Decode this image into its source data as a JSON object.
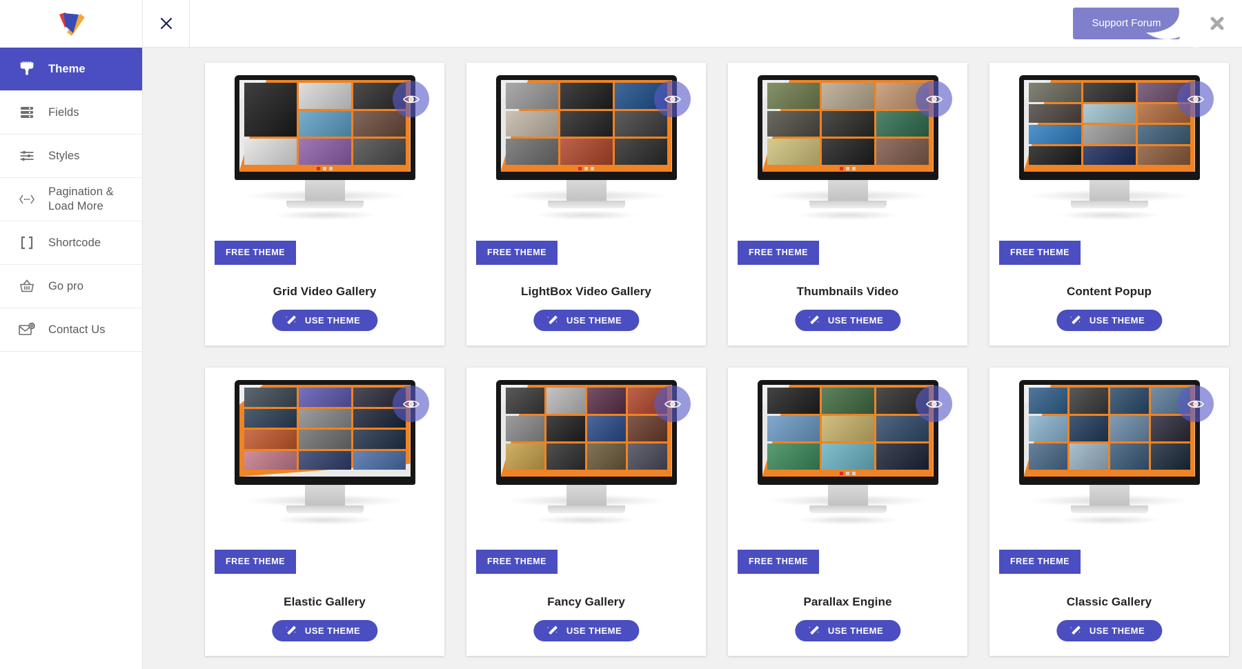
{
  "app": {
    "logo_name": "logo-icon",
    "accent_color": "#4a4ec0",
    "support_button_color": "#7f7fcb",
    "background": "#f1f1f1"
  },
  "topbar": {
    "close_left_icon": "close-icon",
    "support_label": "Support Forum",
    "close_right_icon": "close-icon"
  },
  "sidebar": {
    "items": [
      {
        "label": "Theme",
        "icon": "paint-brush-icon",
        "active": true
      },
      {
        "label": "Fields",
        "icon": "fields-list-icon",
        "active": false
      },
      {
        "label": "Styles",
        "icon": "sliders-icon",
        "active": false
      },
      {
        "label": "Pagination & Load More",
        "icon": "pagination-dots-icon",
        "active": false
      },
      {
        "label": "Shortcode",
        "icon": "brackets-icon",
        "active": false
      },
      {
        "label": "Go pro",
        "icon": "basket-icon",
        "active": false
      },
      {
        "label": "Contact Us",
        "icon": "envelope-at-icon",
        "active": false
      }
    ]
  },
  "themes": {
    "badge_label": "FREE THEME",
    "use_label": "USE THEME",
    "preview_icon": "eye-icon",
    "use_icon": "magic-wand-icon",
    "cards": [
      {
        "title": "Grid Video Gallery",
        "badge": "FREE THEME",
        "use": "USE THEME",
        "layout": "mixed"
      },
      {
        "title": "LightBox Video Gallery",
        "badge": "FREE THEME",
        "use": "USE THEME",
        "layout": "grid33"
      },
      {
        "title": "Thumbnails Video",
        "badge": "FREE THEME",
        "use": "USE THEME",
        "layout": "grid33"
      },
      {
        "title": "Content Popup",
        "badge": "FREE THEME",
        "use": "USE THEME",
        "layout": "grid34"
      },
      {
        "title": "Elastic Gallery",
        "badge": "FREE THEME",
        "use": "USE THEME",
        "layout": "grid34"
      },
      {
        "title": "Fancy Gallery",
        "badge": "FREE THEME",
        "use": "USE THEME",
        "layout": "grid34"
      },
      {
        "title": "Parallax Engine",
        "badge": "FREE THEME",
        "use": "USE THEME",
        "layout": "grid33"
      },
      {
        "title": "Classic Gallery",
        "badge": "FREE THEME",
        "use": "USE THEME",
        "layout": "grid34"
      }
    ]
  }
}
